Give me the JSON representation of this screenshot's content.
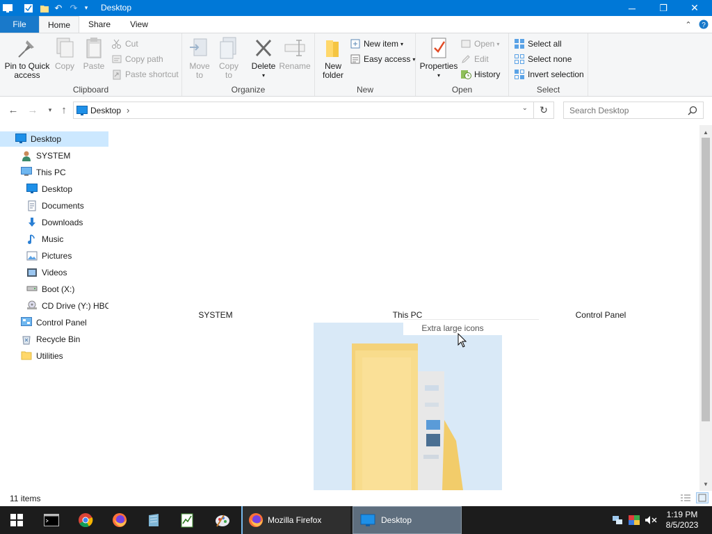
{
  "window": {
    "title": "Desktop",
    "controls": {
      "minimize": "─",
      "maximize": "❐",
      "close": "✕"
    }
  },
  "ribbon_tabs": {
    "file": "File",
    "home": "Home",
    "share": "Share",
    "view": "View"
  },
  "ribbon": {
    "clipboard": {
      "label": "Clipboard",
      "pin": "Pin to Quick access",
      "pin_line1": "Pin to Quick",
      "pin_line2": "access",
      "copy": "Copy",
      "paste": "Paste",
      "cut": "Cut",
      "copy_path": "Copy path",
      "paste_shortcut": "Paste shortcut"
    },
    "organize": {
      "label": "Organize",
      "move_to_1": "Move",
      "move_to_2": "to",
      "copy_to_1": "Copy",
      "copy_to_2": "to",
      "delete": "Delete",
      "rename": "Rename"
    },
    "new": {
      "label": "New",
      "new_folder_1": "New",
      "new_folder_2": "folder",
      "new_item": "New item",
      "easy_access": "Easy access"
    },
    "open": {
      "label": "Open",
      "properties": "Properties",
      "open": "Open",
      "edit": "Edit",
      "history": "History"
    },
    "select": {
      "label": "Select",
      "select_all": "Select all",
      "select_none": "Select none",
      "invert_selection": "Invert selection"
    }
  },
  "address": {
    "path": "Desktop",
    "separator": "›",
    "search_placeholder": "Search Desktop"
  },
  "nav_pane": [
    {
      "label": "Desktop",
      "icon": "desktop-icon",
      "indent": 0,
      "selected": true
    },
    {
      "label": "SYSTEM",
      "icon": "user-icon",
      "indent": 1
    },
    {
      "label": "This PC",
      "icon": "pc-icon",
      "indent": 1
    },
    {
      "label": "Desktop",
      "icon": "desktop-icon",
      "indent": 2
    },
    {
      "label": "Documents",
      "icon": "documents-icon",
      "indent": 2
    },
    {
      "label": "Downloads",
      "icon": "downloads-icon",
      "indent": 2
    },
    {
      "label": "Music",
      "icon": "music-icon",
      "indent": 2
    },
    {
      "label": "Pictures",
      "icon": "pictures-icon",
      "indent": 2
    },
    {
      "label": "Videos",
      "icon": "videos-icon",
      "indent": 2
    },
    {
      "label": "Boot (X:)",
      "icon": "drive-icon",
      "indent": 2
    },
    {
      "label": "CD Drive (Y:) HBC",
      "icon": "cd-drive-icon",
      "indent": 2
    },
    {
      "label": "Control Panel",
      "icon": "control-panel-icon",
      "indent": 1
    },
    {
      "label": "Recycle Bin",
      "icon": "recycle-bin-icon",
      "indent": 1
    },
    {
      "label": "Utilities",
      "icon": "folder-icon",
      "indent": 1
    }
  ],
  "content": {
    "items": [
      "SYSTEM",
      "This PC",
      "Control Panel"
    ],
    "view_tooltip": "Extra large icons"
  },
  "status": {
    "item_count": "11 items"
  },
  "taskbar": {
    "apps": [
      {
        "label": "Mozilla Firefox",
        "icon": "firefox-icon"
      },
      {
        "label": "Desktop",
        "icon": "explorer-icon",
        "active": true
      }
    ],
    "time": "1:19 PM",
    "date": "8/5/2023"
  },
  "colors": {
    "titlebar": "#0078d7",
    "file_tab": "#1979ca",
    "selection": "#cce8ff",
    "taskbar": "#1c1c1c"
  }
}
